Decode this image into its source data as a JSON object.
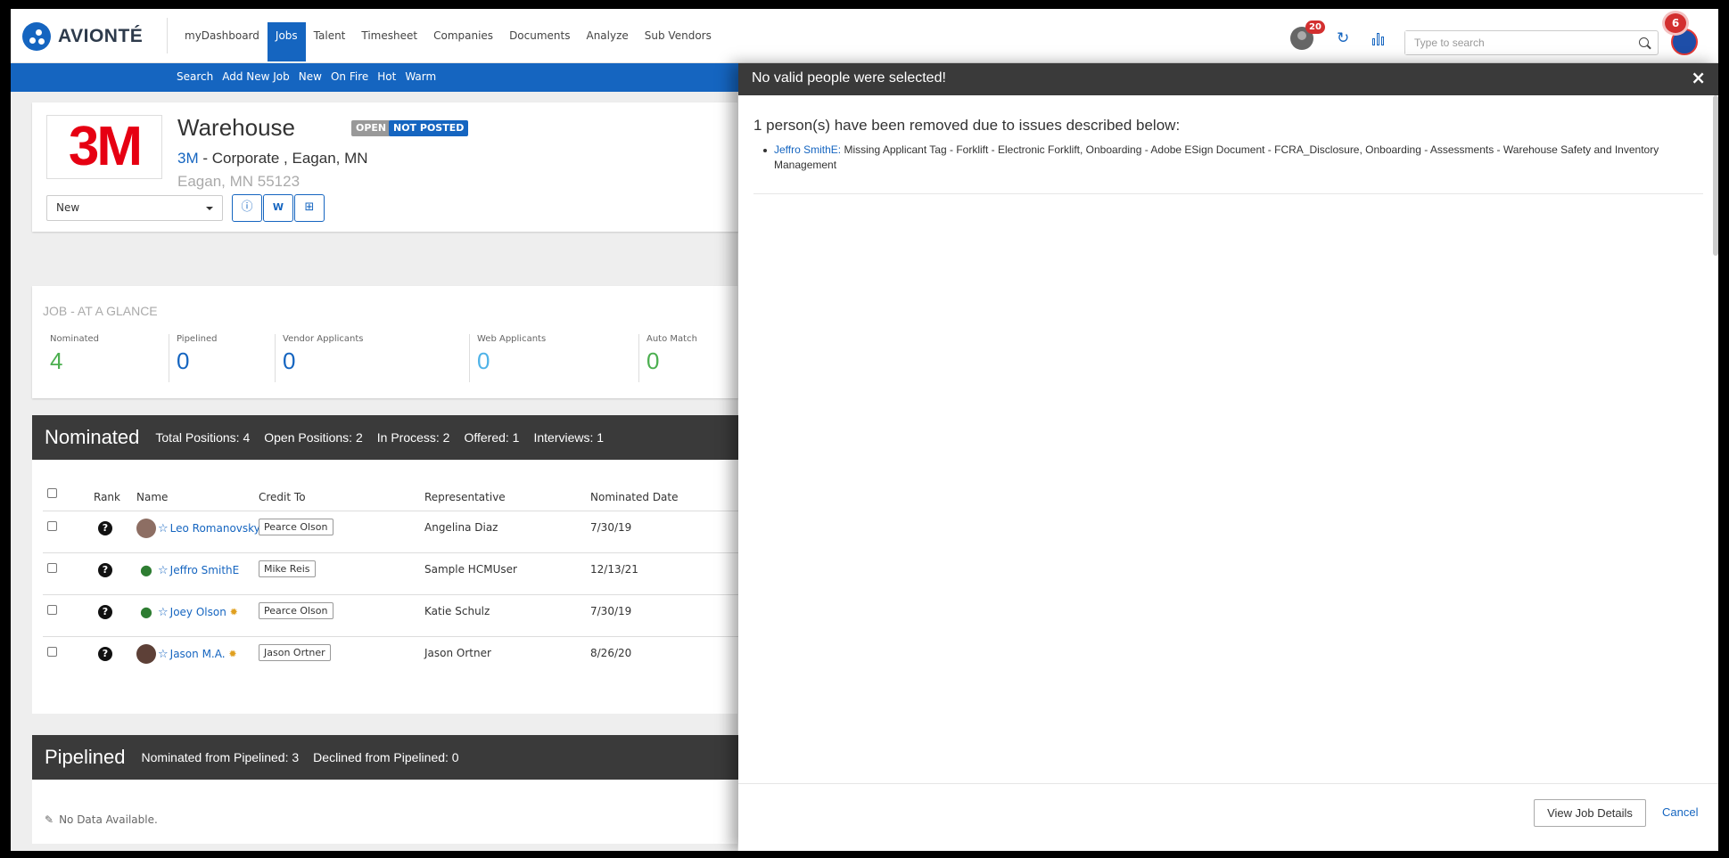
{
  "brand": {
    "name": "AVIONTÉ"
  },
  "nav": [
    "myDashboard",
    "Jobs",
    "Talent",
    "Timesheet",
    "Companies",
    "Documents",
    "Analyze",
    "Sub Vendors"
  ],
  "header": {
    "notification_count": "20",
    "alert_count": "6",
    "search_placeholder": "Type to search"
  },
  "subnav": [
    "Search",
    "Add New Job",
    "New",
    "On Fire",
    "Hot",
    "Warm"
  ],
  "job": {
    "logo_text": "3M",
    "title": "Warehouse",
    "tags": {
      "open": "OPEN",
      "not_posted": "NOT POSTED"
    },
    "company_link": "3M",
    "company_rest": " - Corporate , Eagan, MN",
    "address": "Eagan, MN 55123",
    "status": "New",
    "icon_buttons": [
      "info-icon",
      "word-doc-icon",
      "briefcase-icon"
    ]
  },
  "glance": {
    "title": "JOB - AT A GLANCE",
    "metrics": [
      {
        "label": "Nominated",
        "value": "4",
        "color": "#4caf50"
      },
      {
        "label": "Pipelined",
        "value": "0",
        "color": "#1565c0"
      },
      {
        "label": "Vendor Applicants",
        "value": "0",
        "color": "#1565c0"
      },
      {
        "label": "Web Applicants",
        "value": "0",
        "color": "#4fb3e8"
      },
      {
        "label": "Auto Match",
        "value": "0",
        "color": "#4caf50"
      }
    ]
  },
  "nominated": {
    "title": "Nominated",
    "stats": [
      "Total Positions: 4",
      "Open Positions: 2",
      "In Process: 2",
      "Offered: 1",
      "Interviews: 1"
    ],
    "columns": [
      "Rank",
      "Name",
      "Credit To",
      "Representative",
      "Nominated Date"
    ],
    "rows": [
      {
        "rank": "?",
        "name": "Leo Romanovsky",
        "credit": "Pearce Olson",
        "rep": "Angelina Diaz",
        "date": "7/30/19",
        "avatar": "photo",
        "sun": false
      },
      {
        "rank": "?",
        "name": "Jeffro SmithE",
        "credit": "Mike Reis",
        "rep": "Sample HCMUser",
        "date": "12/13/21",
        "avatar": "person",
        "sun": false
      },
      {
        "rank": "?",
        "name": "Joey Olson",
        "credit": "Pearce Olson",
        "rep": "Katie Schulz",
        "date": "7/30/19",
        "avatar": "person",
        "sun": true
      },
      {
        "rank": "?",
        "name": "Jason M.A.",
        "credit": "Jason Ortner",
        "rep": "Jason Ortner",
        "date": "8/26/20",
        "avatar": "photo",
        "sun": true
      }
    ]
  },
  "pipelined": {
    "title": "Pipelined",
    "stats": [
      "Nominated from Pipelined: 3",
      "Declined from Pipelined: 0"
    ],
    "empty": "No Data Available."
  },
  "modal": {
    "title": "No valid people were selected!",
    "close": "×",
    "message": "1 person(s) have been removed due to issues described below:",
    "issue_person": "Jeffro SmithE:",
    "issue_text": " Missing Applicant Tag - Forklift - Electronic Forklift, Onboarding - Adobe ESign Document - FCRA_Disclosure, Onboarding - Assessments - Warehouse Safety and Inventory Management",
    "view_button": "View Job Details",
    "cancel": "Cancel"
  }
}
